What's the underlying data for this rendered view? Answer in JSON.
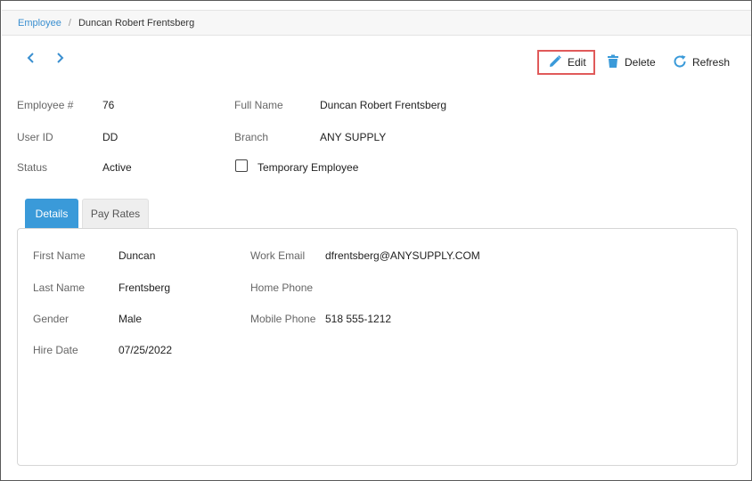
{
  "breadcrumb": {
    "parent": "Employee",
    "separator": "/",
    "current": "Duncan Robert Frentsberg"
  },
  "toolbar": {
    "edit_label": "Edit",
    "delete_label": "Delete",
    "refresh_label": "Refresh"
  },
  "header": {
    "employee_no_label": "Employee #",
    "employee_no_value": "76",
    "full_name_label": "Full Name",
    "full_name_value": "Duncan Robert Frentsberg",
    "user_id_label": "User ID",
    "user_id_value": "DD",
    "branch_label": "Branch",
    "branch_value": "ANY SUPPLY",
    "status_label": "Status",
    "status_value": "Active",
    "temporary_label": "Temporary Employee"
  },
  "tabs": [
    {
      "label": "Details"
    },
    {
      "label": "Pay Rates"
    }
  ],
  "details": {
    "first_name_label": "First Name",
    "first_name_value": "Duncan",
    "last_name_label": "Last Name",
    "last_name_value": "Frentsberg",
    "gender_label": "Gender",
    "gender_value": "Male",
    "hire_date_label": "Hire Date",
    "hire_date_value": "07/25/2022",
    "work_email_label": "Work Email",
    "work_email_value": "dfrentsberg@ANYSUPPLY.COM",
    "home_phone_label": "Home Phone",
    "mobile_phone_label": "Mobile Phone",
    "mobile_phone_value": "518 555-1212"
  },
  "colors": {
    "accent": "#3a9ad9",
    "highlight_border": "#e05a5a"
  },
  "icons": {
    "prev": "chevron-left-icon",
    "next": "chevron-right-icon",
    "edit": "pencil-icon",
    "delete": "trash-icon",
    "refresh": "refresh-icon"
  }
}
